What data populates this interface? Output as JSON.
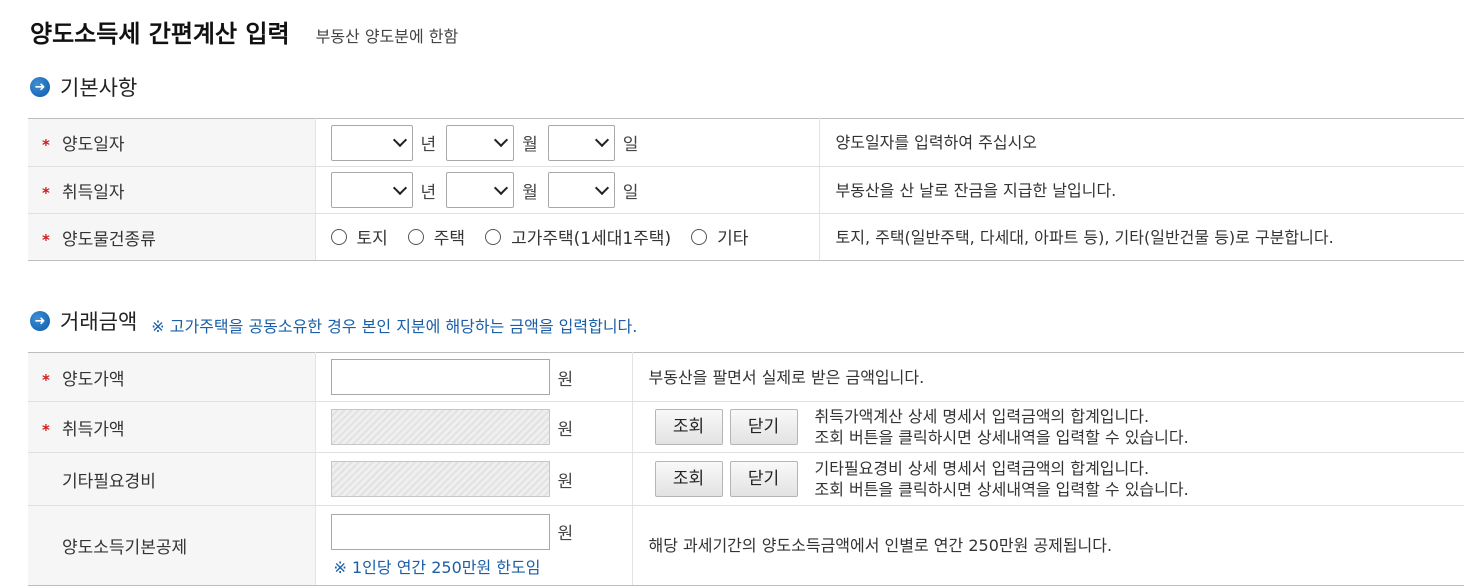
{
  "header": {
    "title": "양도소득세 간편계산 입력",
    "subtitle": "부동산 양도분에 한함"
  },
  "basic": {
    "section_title": "기본사항",
    "rows": {
      "transfer_date": {
        "label": "양도일자",
        "year_unit": "년",
        "month_unit": "월",
        "day_unit": "일",
        "desc": "양도일자를 입력하여 주십시오"
      },
      "acquire_date": {
        "label": "취득일자",
        "year_unit": "년",
        "month_unit": "월",
        "day_unit": "일",
        "desc": "부동산을 산 날로 잔금을 지급한 날입니다."
      },
      "property_type": {
        "label": "양도물건종류",
        "options": [
          "토지",
          "주택",
          "고가주택(1세대1주택)",
          "기타"
        ],
        "desc": "토지, 주택(일반주택, 다세대, 아파트 등), 기타(일반건물 등)로 구분합니다."
      }
    }
  },
  "amount": {
    "section_title": "거래금액",
    "note": "※ 고가주택을 공동소유한 경우 본인 지분에 해당하는 금액을 입력합니다.",
    "rows": {
      "transfer_price": {
        "label": "양도가액",
        "unit": "원",
        "desc": "부동산을 팔면서 실제로 받은 금액입니다."
      },
      "acquire_price": {
        "label": "취득가액",
        "unit": "원",
        "view_btn": "조회",
        "close_btn": "닫기",
        "desc1": "취득가액계산 상세 명세서 입력금액의 합계입니다.",
        "desc2": "조회 버튼을 클릭하시면 상세내역을 입력할 수 있습니다."
      },
      "other_expenses": {
        "label": "기타필요경비",
        "unit": "원",
        "view_btn": "조회",
        "close_btn": "닫기",
        "desc1": "기타필요경비 상세 명세서 입력금액의 합계입니다.",
        "desc2": "조회 버튼을 클릭하시면 상세내역을 입력할 수 있습니다."
      },
      "basic_deduction": {
        "label": "양도소득기본공제",
        "unit": "원",
        "limit_note": "※ 1인당 연간 250만원 한도임",
        "desc": "해당 과세기간의 양도소득금액에서 인별로 연간 250만원 공제됩니다."
      }
    }
  },
  "colors": {
    "required_mark": "#d21c1c",
    "note_blue": "#1a5fa8",
    "section_icon": "#0b5aa8"
  },
  "icons": {
    "section": "arrow-circle-right-icon",
    "select": "chevron-down-icon",
    "required": "asterisk-icon"
  }
}
